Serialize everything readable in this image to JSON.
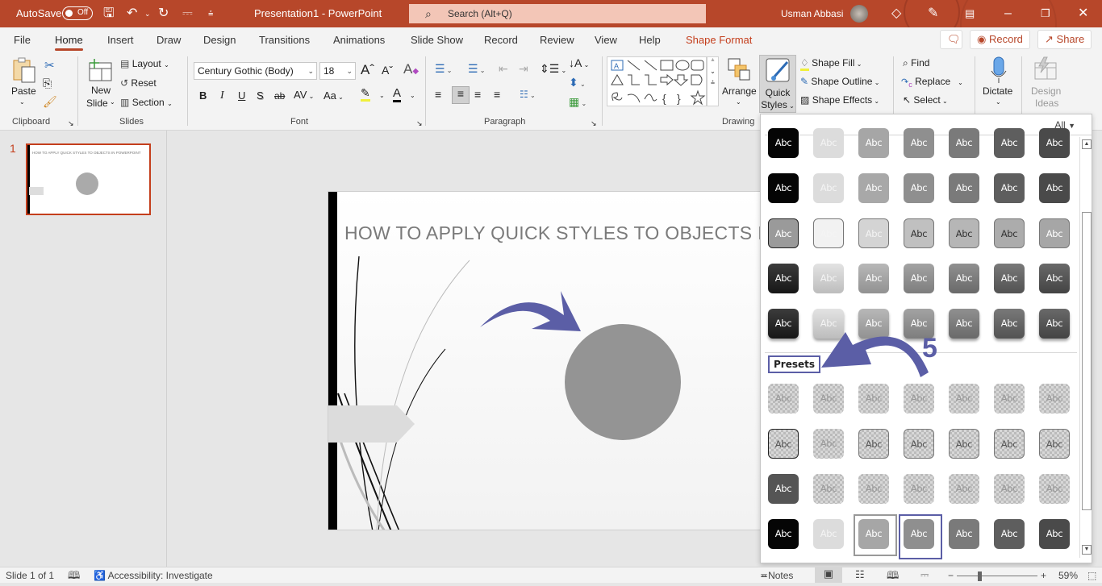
{
  "titlebar": {
    "autosave_label": "AutoSave",
    "autosave_state": "Off",
    "doc_title": "Presentation1  -  PowerPoint",
    "search_placeholder": "Search (Alt+Q)",
    "user_name": "Usman Abbasi",
    "icons": [
      "save-icon",
      "undo-icon",
      "redo-icon",
      "present-icon",
      "customize-qat-icon",
      "diamond-icon",
      "pen-icon",
      "ribbon-display-icon",
      "minimize-icon",
      "restore-icon",
      "close-icon"
    ]
  },
  "menu": {
    "tabs": [
      "File",
      "Home",
      "Insert",
      "Draw",
      "Design",
      "Transitions",
      "Animations",
      "Slide Show",
      "Record",
      "Review",
      "View",
      "Help",
      "Shape Format"
    ],
    "active_tab": "Home",
    "record_label": "Record",
    "share_label": "Share"
  },
  "ribbon": {
    "clipboard": {
      "label": "Clipboard",
      "paste": "Paste"
    },
    "slides": {
      "label": "Slides",
      "new_slide_1": "New",
      "new_slide_2": "Slide",
      "layout": "Layout",
      "reset": "Reset",
      "section": "Section"
    },
    "font": {
      "label": "Font",
      "font_name": "Century Gothic (Body)",
      "font_size": "18",
      "bold": "B",
      "italic": "I",
      "underline": "U",
      "shadow": "S",
      "strike": "ab",
      "spacing": "AV",
      "case": "Aa"
    },
    "paragraph": {
      "label": "Paragraph"
    },
    "drawing": {
      "label": "Drawing",
      "arrange": "Arrange",
      "quick_styles_1": "Quick",
      "quick_styles_2": "Styles",
      "shape_fill": "Shape Fill",
      "shape_outline": "Shape Outline",
      "shape_effects": "Shape Effects"
    },
    "editing": {
      "find": "Find",
      "replace": "Replace",
      "select": "Select"
    },
    "voice": {
      "dictate": "Dictate"
    },
    "designer": {
      "design_ideas_1": "Design",
      "design_ideas_2": "Ideas"
    }
  },
  "thumbnails": [
    {
      "number": "1",
      "title": "HOW TO APPLY QUICK STYLES TO  OBJECTS  IN POWERPOINT"
    }
  ],
  "slide": {
    "title": "HOW TO APPLY QUICK STYLES TO  OBJECTS  IN POWERPOINT"
  },
  "gallery": {
    "filter": "All",
    "presets_label": "Presets",
    "annotation_number": "5",
    "swatch_text": "Abc",
    "theme_rows": [
      [
        "#050505",
        "#dcdcdc",
        "#a6a6a6",
        "#8f8f8f",
        "#7a7a7a",
        "#5e5e5e",
        "#4a4a4a"
      ],
      [
        "#050505",
        "#dcdcdc",
        "#a8a8a8",
        "#8f8f8f",
        "#7a7a7a",
        "#5e5e5e",
        "#4a4a4a"
      ],
      [
        "#9a9a9a",
        "#f2f2f2",
        "#d4d4d4",
        "#c0c0c0",
        "#b6b6b6",
        "#acacac",
        "#a6a6a6"
      ],
      [
        "#1a1a1a",
        "#dedede",
        "#ababab",
        "#939393",
        "#7c7c7c",
        "#616161",
        "#4f4f4f"
      ],
      [
        "#1a1a1a",
        "#dedede",
        "#ababab",
        "#939393",
        "#7c7c7c",
        "#616161",
        "#4f4f4f"
      ]
    ],
    "preset_rows": [
      [
        "checker",
        "checker",
        "checker",
        "checker",
        "checker",
        "checker",
        "checker"
      ],
      [
        "checker",
        "checker",
        "checker",
        "checker",
        "checker",
        "checker",
        "checker"
      ],
      [
        "#555555",
        "checker",
        "checker",
        "checker",
        "checker",
        "checker",
        "checker"
      ],
      [
        "#050505",
        "#dcdcdc",
        "#a6a6a6",
        "#8f8f8f",
        "#7a7a7a",
        "#5e5e5e",
        "#4a4a4a"
      ]
    ]
  },
  "status": {
    "slide_info": "Slide 1 of 1",
    "accessibility": "Accessibility: Investigate",
    "notes": "Notes",
    "zoom": "59%"
  },
  "colors": {
    "brand": "#b7472a",
    "annotation": "#5b5ea6",
    "shape_fill": "#949494"
  }
}
